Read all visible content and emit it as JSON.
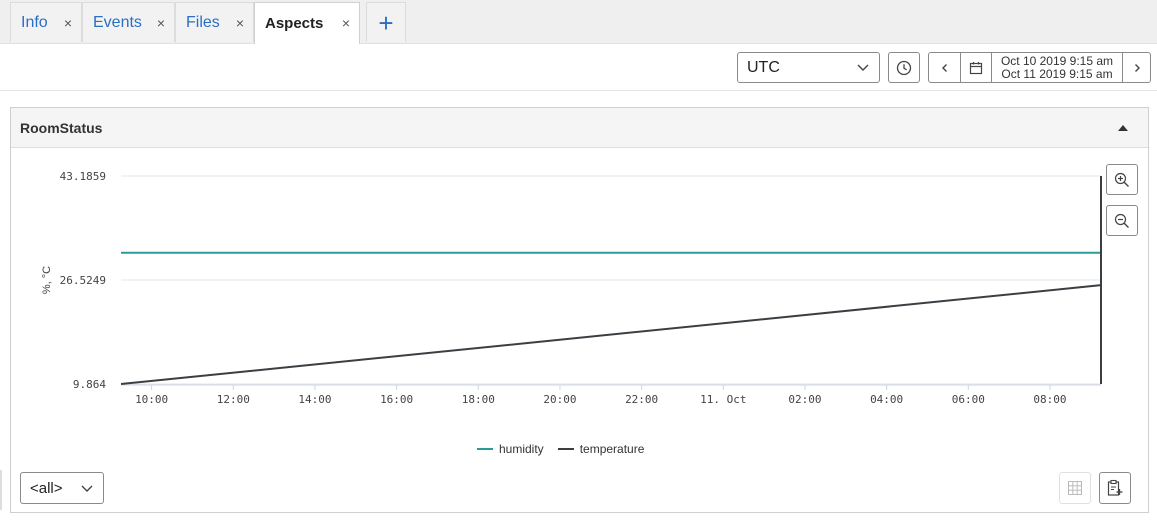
{
  "tabs": [
    {
      "label": "Info",
      "active": false
    },
    {
      "label": "Events",
      "active": false
    },
    {
      "label": "Files",
      "active": false
    },
    {
      "label": "Aspects",
      "active": true
    }
  ],
  "tab_close_glyph": "×",
  "tab_add_glyph": "+",
  "toolbar": {
    "timezone": "UTC",
    "range_start": "Oct 10 2019 9:15 am",
    "range_end": "Oct 11 2019 9:15 am"
  },
  "panel": {
    "title": "RoomStatus"
  },
  "filter": {
    "selected": "<all>"
  },
  "colors": {
    "humidity": "#2a9b9b",
    "temperature": "#3a3f44",
    "grid": "#e6e6e6",
    "axis_text": "#444444"
  },
  "chart_data": {
    "type": "line",
    "title": "",
    "ylabel": "%, °C",
    "ylim": [
      9.864,
      43.1859
    ],
    "yticks": [
      "43.1859",
      "26.5249",
      "9.864"
    ],
    "xticks": [
      "10:00",
      "12:00",
      "14:00",
      "16:00",
      "18:00",
      "20:00",
      "22:00",
      "11. Oct",
      "02:00",
      "04:00",
      "06:00",
      "08:00"
    ],
    "x_range_hours": [
      9.25,
      33.25
    ],
    "series": [
      {
        "name": "humidity",
        "x": [
          9.25,
          33.25
        ],
        "values": [
          30.9,
          30.9
        ]
      },
      {
        "name": "temperature",
        "x": [
          9.25,
          33.25
        ],
        "values": [
          9.864,
          25.7
        ]
      }
    ],
    "legend": "bottom-center",
    "grid": true
  }
}
